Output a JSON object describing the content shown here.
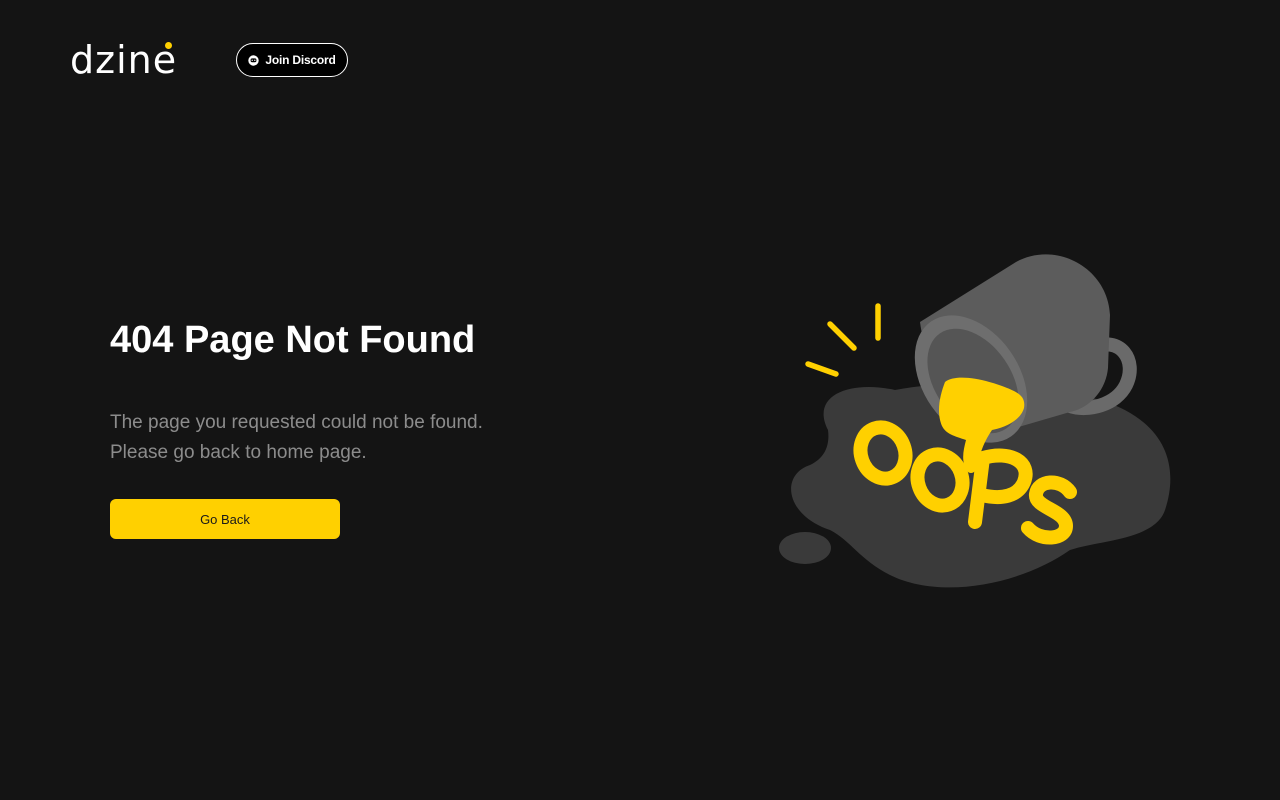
{
  "header": {
    "logo_text": "dzine",
    "discord_label": "Join Discord"
  },
  "main": {
    "title": "404 Page Not Found",
    "description_lines": [
      "The page you requested could not be found.",
      "Please go back to home page."
    ],
    "go_back_label": "Go Back"
  },
  "illustration": {
    "text": "OOPS"
  },
  "colors": {
    "background": "#141414",
    "accent": "#ffd000",
    "text_primary": "#ffffff",
    "text_secondary": "#8c8c8c",
    "mug": "#6a6a6a",
    "puddle": "#3a3a3a"
  },
  "icons": {
    "discord": "discord-icon",
    "illustration": "spilled-mug-illustration"
  }
}
